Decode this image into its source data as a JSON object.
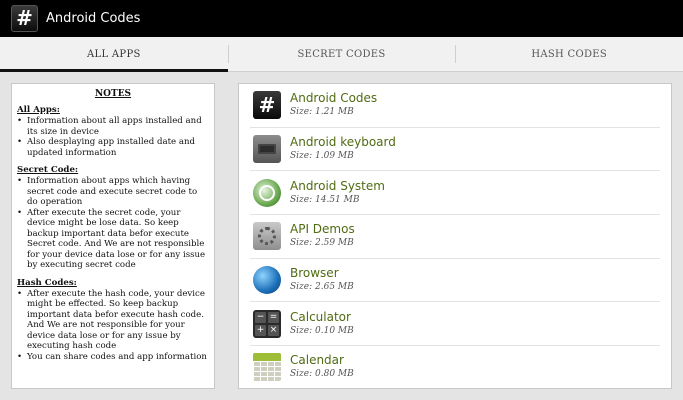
{
  "app": {
    "title": "Android Codes",
    "icon_glyph": "#"
  },
  "tabs": [
    {
      "label": "ALL APPS",
      "active": true
    },
    {
      "label": "SECRET CODES",
      "active": false
    },
    {
      "label": "HASH CODES",
      "active": false
    }
  ],
  "notes": {
    "title": "NOTES",
    "sections": [
      {
        "heading": "All Apps:",
        "items": [
          "Information about all apps installed and its size in device",
          "Also desplaying app installed date and updated information"
        ]
      },
      {
        "heading": "Secret Code:",
        "items": [
          "Information about apps which having secret code and execute secret code to do operation",
          "After execute the secret code, your device might be lose data. So keep backup important data befor execute Secret code. And We are not responsible for your device data lose or for any issue by executing secret code"
        ]
      },
      {
        "heading": "Hash Codes:",
        "items": [
          "After execute the hash code, your device might be effected. So keep backup important data befor execute hash code. And We are not responsible for your device data lose or for any issue by executing hash code"
        ]
      }
    ],
    "footer": "You can share codes and app information"
  },
  "apps": [
    {
      "name": "Android Codes",
      "size": "Size: 1.21 MB",
      "icon": "hash-icon"
    },
    {
      "name": "Android keyboard",
      "size": "Size: 1.09 MB",
      "icon": "keyboard-icon"
    },
    {
      "name": "Android System",
      "size": "Size: 14.51 MB",
      "icon": "android-system-icon"
    },
    {
      "name": "API Demos",
      "size": "Size: 2.59 MB",
      "icon": "folder-gear-icon"
    },
    {
      "name": "Browser",
      "size": "Size: 2.65 MB",
      "icon": "globe-icon"
    },
    {
      "name": "Calculator",
      "size": "Size: 0.10 MB",
      "icon": "calculator-icon"
    },
    {
      "name": "Calendar",
      "size": "Size: 0.80 MB",
      "icon": "calendar-icon"
    }
  ],
  "calculator_glyphs": [
    "−",
    "=",
    "+",
    "×"
  ],
  "colors": {
    "titlebar": "#000000",
    "app_name": "#4f6b12",
    "tab_indicator": "#111111"
  }
}
